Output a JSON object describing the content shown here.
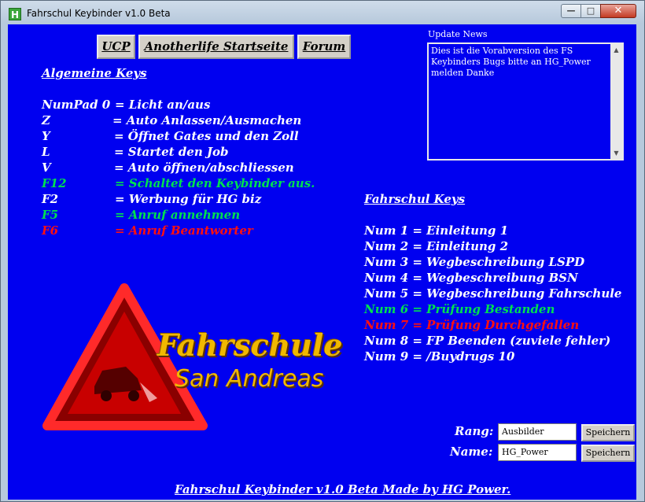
{
  "window": {
    "title": "Fahrschul Keybinder v1.0 Beta",
    "app_icon": "H",
    "min_glyph": "—",
    "max_glyph": "□",
    "close_glyph": "✕"
  },
  "nav": {
    "ucp": "UCP",
    "startseite": "Anotherlife Startseite",
    "forum": "Forum"
  },
  "general": {
    "heading": "Algemeine Keys",
    "keys": [
      {
        "key": "NumPad 0",
        "action": "= Licht an/aus"
      },
      {
        "key": "Z",
        "action": "= Auto Anlassen/Ausmachen"
      },
      {
        "key": "Y",
        "action": "= Öffnet Gates und den Zoll"
      },
      {
        "key": "L",
        "action": "= Startet den Job"
      },
      {
        "key": "V",
        "action": "= Auto öffnen/abschliessen"
      },
      {
        "key": "F12",
        "action": "= Schaltet den Keybinder aus."
      },
      {
        "key": "F2",
        "action": "= Werbung für HG biz"
      },
      {
        "key": "F5",
        "action": "= Anruf annehmen"
      },
      {
        "key": "F6",
        "action": "= Anruf Beantworter"
      }
    ]
  },
  "school": {
    "heading": "Fahrschul Keys",
    "keys": [
      "Num 1  = Einleitung 1",
      "Num 2 = Einleitung 2",
      "Num 3 = Wegbeschreibung LSPD",
      "Num 4 = Wegbeschreibung BSN",
      "Num 5 = Wegbeschreibung Fahrschule",
      "Num 6 = Prüfung Bestanden",
      "Num 7 = Prüfung Durchgefallen",
      "Num 8 = FP Beenden (zuviele fehler)",
      "Num 9 = /Buydrugs 10"
    ]
  },
  "news": {
    "label": "Update News",
    "text": "Dies ist die Vorabversion des FS Keybinders Bugs bitte an HG_Power melden Danke"
  },
  "logo": {
    "line1": "Fahrschule",
    "line2": "San Andreas"
  },
  "form": {
    "rang_label": "Rang:",
    "rang_value": "Ausbilder",
    "name_label": "Name:",
    "name_value": "HG_Power",
    "save_label": "Speichern"
  },
  "footer": "Fahrschul Keybinder v1.0 Beta Made by HG Power.",
  "colors": {
    "background": "#0000f0",
    "highlight_green": "#00e050",
    "highlight_red": "#ff1010"
  }
}
